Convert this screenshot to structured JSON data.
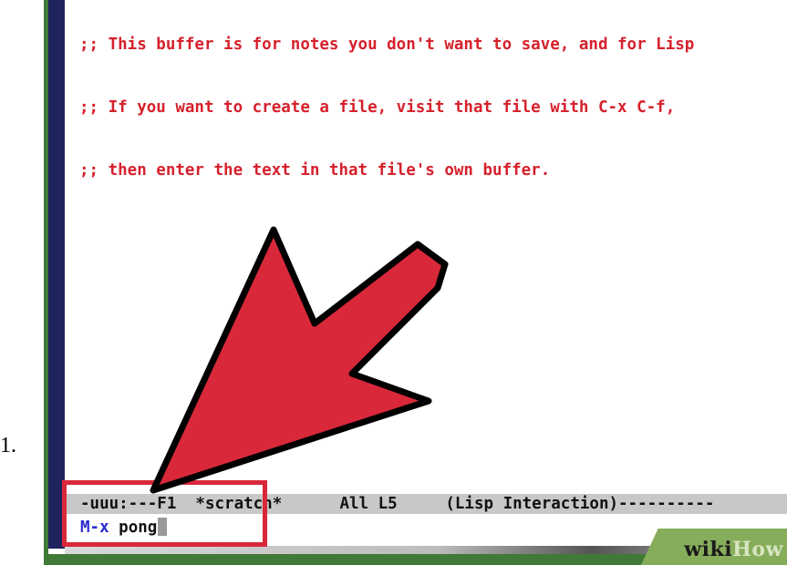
{
  "list_marker": "1.",
  "buffer": {
    "lines": [
      ";; This buffer is for notes you don't want to save, and for Lisp",
      ";; If you want to create a file, visit that file with C-x C-f,",
      ";; then enter the text in that file's own buffer."
    ]
  },
  "modeline": {
    "text": "-uuu:---F1  *scratch*      All L5     (Lisp Interaction)----------"
  },
  "minibuffer": {
    "prompt": "M-x",
    "command": "pong"
  },
  "watermark": {
    "wiki": "wiki",
    "how": "How"
  },
  "colors": {
    "comment_text": "#d6212c",
    "fringe": "#20245e",
    "frame_green": "#3f7a36",
    "annotation_red": "#d8283a",
    "prompt_blue": "#2a2ad0"
  }
}
